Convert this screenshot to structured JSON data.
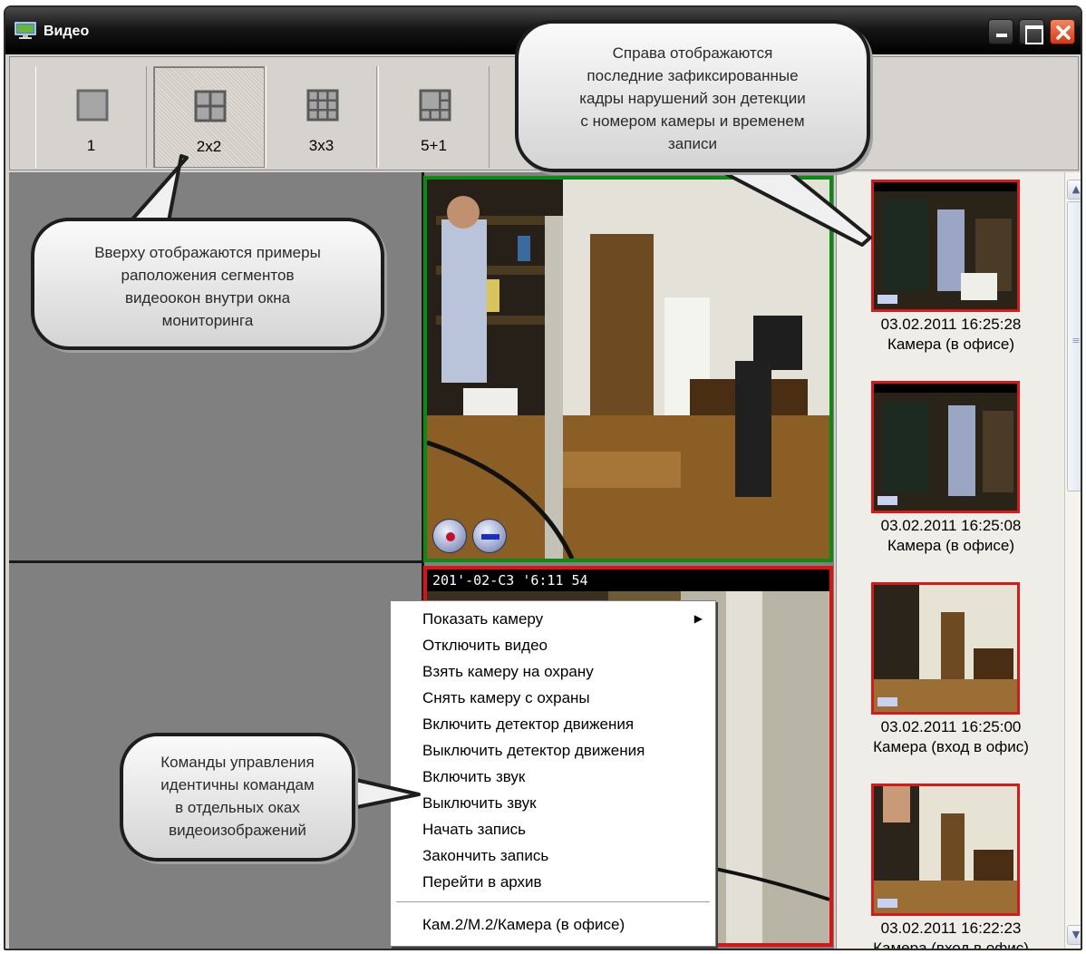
{
  "window": {
    "title": "Видео",
    "icons": [
      "monitor-icon",
      "minimize-icon",
      "maximize-icon",
      "close-icon"
    ]
  },
  "layouts": {
    "buttons": [
      {
        "label": "1",
        "icon": "single-grid-icon"
      },
      {
        "label": "2x2",
        "icon": "grid-2x2-icon",
        "active": true
      },
      {
        "label": "3x3",
        "icon": "grid-3x3-icon"
      },
      {
        "label": "5+1",
        "icon": "grid-5plus1-icon"
      }
    ]
  },
  "video": {
    "timestamp": "201'-02-C3 '6:11 54",
    "border_colors": {
      "active": "#0d8a14",
      "alarm": "#d91414"
    },
    "controls": [
      "record-icon",
      "detector-icon"
    ]
  },
  "thumbnails": [
    {
      "date": "03.02.2011 16:25:28",
      "camera": "Камера (в офисе)",
      "timestamp": "2011-02-03 16:25"
    },
    {
      "date": "03.02.2011 16:25:08",
      "camera": "Камера (в офисе)",
      "timestamp": "2011-02-03 16:25"
    },
    {
      "date": "03.02.2011 16:25:00",
      "camera": "Камера (вход в офис)"
    },
    {
      "date": "03.02.2011 16:22:23",
      "camera": "Камера (вход в офис)"
    }
  ],
  "context_menu": {
    "items": [
      {
        "label": "Показать камеру",
        "has_submenu": true
      },
      {
        "label": "Отключить видео"
      },
      {
        "label": "Взять камеру на охрану"
      },
      {
        "label": "Снять камеру с охраны"
      },
      {
        "label": "Включить детектор движения"
      },
      {
        "label": "Выключить детектор движения"
      },
      {
        "label": "Включить звук"
      },
      {
        "label": "Выключить звук"
      },
      {
        "label": "Начать запись"
      },
      {
        "label": "Закончить запись"
      },
      {
        "label": "Перейти в архив"
      }
    ],
    "footer": "Кам.2/М.2/Камера (в офисе)",
    "submenu_arrow": "▶"
  },
  "callouts": {
    "top": [
      "Справа отображаются",
      "последние зафиксированные",
      "кадры нарушений зон детекции",
      "с номером камеры и временем",
      "записи"
    ],
    "left": [
      "Вверху отображаются примеры",
      "раположения сегментов",
      "видеоокон внутри окна",
      "мониторинга"
    ],
    "bottom": [
      "Команды управления",
      "идентичны командам",
      "в отдельных оках",
      "видеоизображений"
    ]
  }
}
